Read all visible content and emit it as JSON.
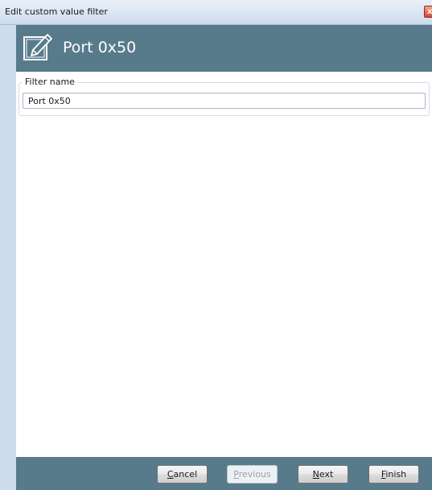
{
  "window": {
    "title": "Edit custom value filter",
    "close_glyph": "x",
    "close_icon": "close-icon",
    "accent": "#587b8c"
  },
  "header": {
    "icon": "edit-icon",
    "title": "Port 0x50"
  },
  "form": {
    "group_label": "Filter name",
    "filter_name_value": "Port 0x50",
    "filter_name_placeholder": ""
  },
  "buttons": {
    "cancel": {
      "mnemonic": "C",
      "rest": "ancel",
      "enabled": true
    },
    "previous": {
      "mnemonic": "P",
      "rest": "revious",
      "enabled": false
    },
    "next": {
      "mnemonic": "N",
      "rest": "ext",
      "enabled": true
    },
    "finish": {
      "mnemonic": "F",
      "rest": "inish",
      "enabled": true
    }
  }
}
